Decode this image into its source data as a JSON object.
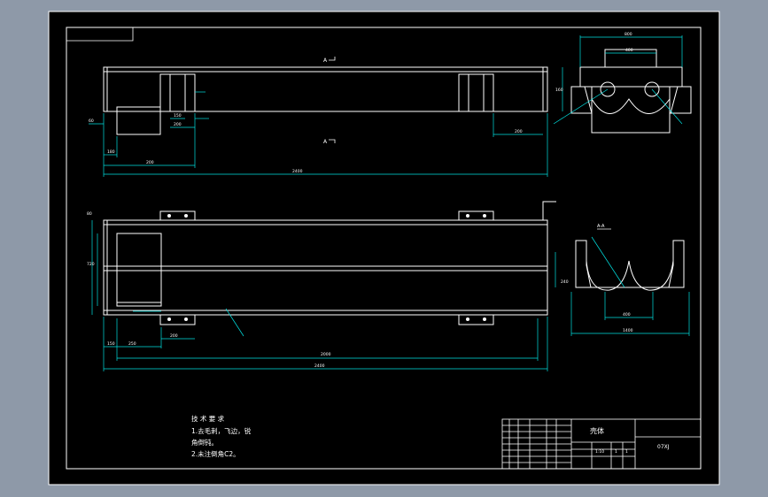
{
  "drawing": {
    "section_marks": {
      "top": "A",
      "bottom": "A"
    },
    "section_title": "A-A",
    "dimensions": {
      "front_left": "60",
      "front_a": "180",
      "front_b": "200",
      "front_c": "150",
      "front_d": "200",
      "front_e": "200",
      "front_total": "2400",
      "side_width": "800",
      "side_height": "160",
      "side_right": "400",
      "plan_height": "720",
      "plan_small": "80",
      "plan_a": "150",
      "plan_b": "250",
      "plan_c": "200",
      "plan_mid": "2000",
      "plan_total": "2400",
      "sec_height": "240",
      "sec_inner": "400",
      "sec_total": "1400"
    },
    "notes": {
      "heading": "技 术 要 求",
      "line1": "1.去毛刺，飞边，锐",
      "line2": "角倒钝。",
      "line3": "2.未注倒角C2。"
    },
    "title_block": {
      "part_name": "壳体",
      "drawing_no": "07XJ",
      "scale": "1:10",
      "sheet": "1",
      "qty": "1"
    }
  }
}
